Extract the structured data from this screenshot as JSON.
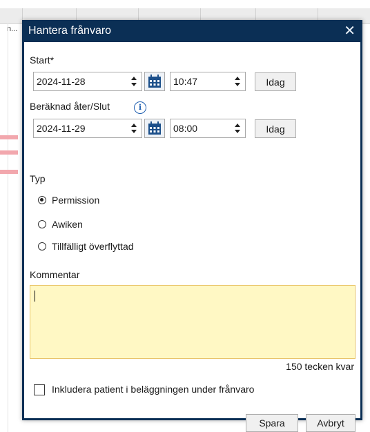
{
  "background": {
    "stub_text": "n..."
  },
  "dialog": {
    "title": "Hantera frånvaro",
    "start": {
      "label": "Start*",
      "date": "2024-11-28",
      "time": "10:47",
      "today_button": "Idag"
    },
    "end": {
      "label": "Beräknad åter/Slut",
      "info_glyph": "i",
      "date": "2024-11-29",
      "time": "08:00",
      "today_button": "Idag"
    },
    "type": {
      "label": "Typ",
      "options": [
        {
          "label": "Permission",
          "selected": true
        },
        {
          "label": "Awiken",
          "selected": false
        },
        {
          "label": "Tillfälligt överflyttad",
          "selected": false
        }
      ]
    },
    "comment": {
      "label": "Kommentar",
      "value": "",
      "remaining": "150 tecken kvar"
    },
    "include_checkbox": {
      "label": "Inkludera patient i beläggningen under frånvaro",
      "checked": false
    },
    "buttons": {
      "save": "Spara",
      "cancel": "Avbryt"
    }
  },
  "colors": {
    "titlebar": "#0b2f55",
    "comment_bg": "#fff8c4",
    "comment_border": "#e9c46a",
    "info_icon": "#1f5fb0",
    "calendar_icon": "#1b4f8a",
    "background_marker": "#f2a7ad"
  },
  "icons": [
    "close-icon",
    "calendar-icon",
    "info-icon",
    "spinner-icon"
  ]
}
